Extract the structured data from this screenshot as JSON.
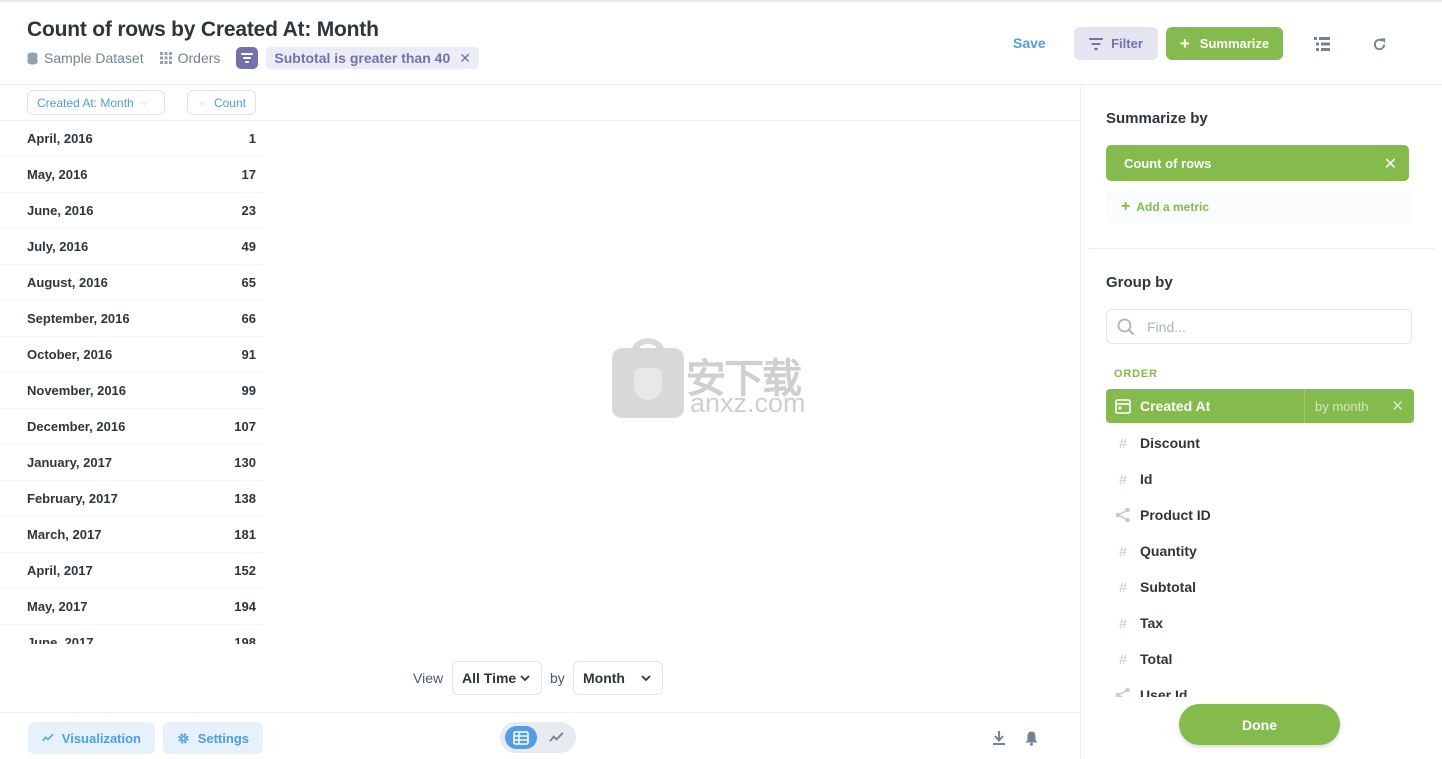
{
  "header": {
    "title": "Count of rows by Created At: Month",
    "crumbs": {
      "database": "Sample Dataset",
      "table": "Orders"
    },
    "filter_pill": "Subtotal is greater than 40",
    "save_label": "Save",
    "filter_label": "Filter",
    "summarize_label": "Summarize"
  },
  "table": {
    "columns": [
      "Created At: Month",
      "Count"
    ],
    "rows": [
      {
        "month": "April, 2016",
        "count": "1"
      },
      {
        "month": "May, 2016",
        "count": "17"
      },
      {
        "month": "June, 2016",
        "count": "23"
      },
      {
        "month": "July, 2016",
        "count": "49"
      },
      {
        "month": "August, 2016",
        "count": "65"
      },
      {
        "month": "September, 2016",
        "count": "66"
      },
      {
        "month": "October, 2016",
        "count": "91"
      },
      {
        "month": "November, 2016",
        "count": "99"
      },
      {
        "month": "December, 2016",
        "count": "107"
      },
      {
        "month": "January, 2017",
        "count": "130"
      },
      {
        "month": "February, 2017",
        "count": "138"
      },
      {
        "month": "March, 2017",
        "count": "181"
      },
      {
        "month": "April, 2017",
        "count": "152"
      },
      {
        "month": "May, 2017",
        "count": "194"
      },
      {
        "month": "June, 2017",
        "count": "198"
      }
    ]
  },
  "watermark": {
    "chinese": "安下载",
    "latin": "anxz.com"
  },
  "view_controls": {
    "view_label": "View",
    "time_range": "All Time",
    "by_label": "by",
    "granularity": "Month"
  },
  "footer": {
    "visualization_label": "Visualization",
    "settings_label": "Settings"
  },
  "sidebar": {
    "summarize_title": "Summarize by",
    "metric": "Count of rows",
    "add_metric": "Add a metric",
    "group_title": "Group by",
    "find_placeholder": "Find...",
    "section": "ORDER",
    "fields": [
      {
        "name": "Created At",
        "icon": "calendar-icon",
        "selected": true,
        "bucket": "by month"
      },
      {
        "name": "Discount",
        "icon": "number-icon"
      },
      {
        "name": "Id",
        "icon": "number-icon"
      },
      {
        "name": "Product ID",
        "icon": "connection-icon"
      },
      {
        "name": "Quantity",
        "icon": "number-icon"
      },
      {
        "name": "Subtotal",
        "icon": "number-icon"
      },
      {
        "name": "Tax",
        "icon": "number-icon"
      },
      {
        "name": "Total",
        "icon": "number-icon"
      },
      {
        "name": "User Id",
        "icon": "connection-icon"
      }
    ],
    "done_label": "Done"
  },
  "colors": {
    "brand": "#509ee3",
    "summarize": "#84bb4c",
    "filter": "#7172ad"
  }
}
